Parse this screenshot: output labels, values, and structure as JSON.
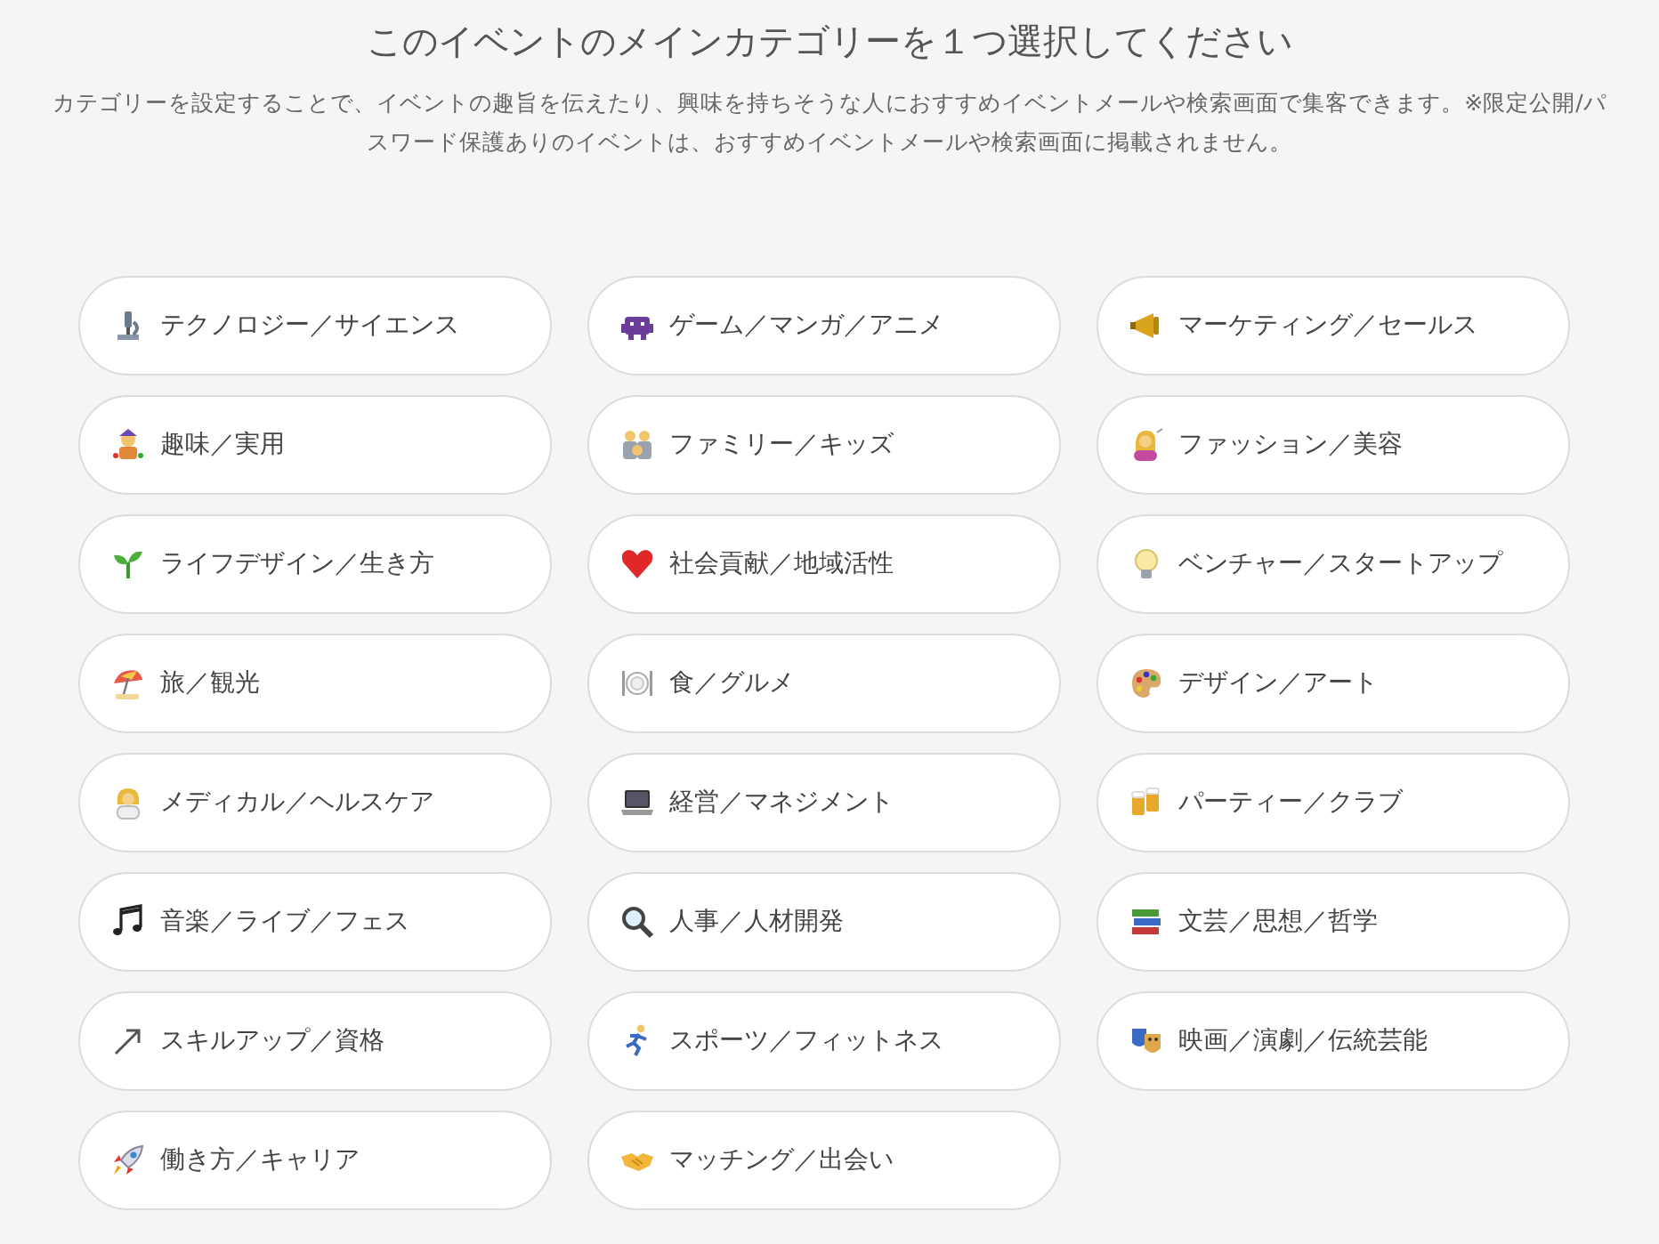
{
  "heading": "このイベントのメインカテゴリーを１つ選択してください",
  "description": "カテゴリーを設定することで、イベントの趣旨を伝えたり、興味を持ちそうな人におすすめイベントメールや検索画面で集客できます。※限定公開/パスワード保護ありのイベントは、おすすめイベントメールや検索画面に掲載されません。",
  "categories": [
    {
      "label": "テクノロジー／サイエンス"
    },
    {
      "label": "ゲーム／マンガ／アニメ"
    },
    {
      "label": "マーケティング／セールス"
    },
    {
      "label": "趣味／実用"
    },
    {
      "label": "ファミリー／キッズ"
    },
    {
      "label": "ファッション／美容"
    },
    {
      "label": "ライフデザイン／生き方"
    },
    {
      "label": "社会貢献／地域活性"
    },
    {
      "label": "ベンチャー／スタートアップ"
    },
    {
      "label": "旅／観光"
    },
    {
      "label": "食／グルメ"
    },
    {
      "label": "デザイン／アート"
    },
    {
      "label": "メディカル／ヘルスケア"
    },
    {
      "label": "経営／マネジメント"
    },
    {
      "label": "パーティー／クラブ"
    },
    {
      "label": "音楽／ライブ／フェス"
    },
    {
      "label": "人事／人材開発"
    },
    {
      "label": "文芸／思想／哲学"
    },
    {
      "label": "スキルアップ／資格"
    },
    {
      "label": "スポーツ／フィットネス"
    },
    {
      "label": "映画／演劇／伝統芸能"
    },
    {
      "label": "働き方／キャリア"
    },
    {
      "label": "マッチング／出会い"
    }
  ]
}
